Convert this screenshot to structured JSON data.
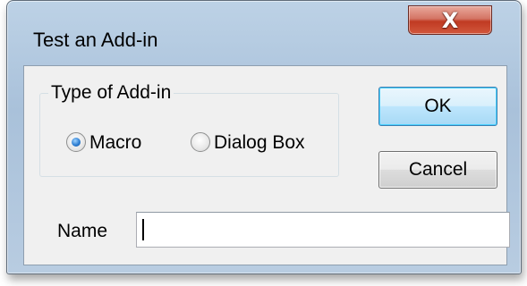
{
  "window": {
    "title": "Test an Add-in",
    "close_glyph": "X"
  },
  "group": {
    "label": "Type of Add-in",
    "options": [
      {
        "label": "Macro",
        "selected": true
      },
      {
        "label": "Dialog Box",
        "selected": false
      }
    ]
  },
  "buttons": {
    "ok": "OK",
    "cancel": "Cancel"
  },
  "name_field": {
    "label": "Name",
    "value": ""
  },
  "colors": {
    "title_bar": "#a9c1da",
    "close_button": "#c03a22",
    "client_bg": "#f0f0f0",
    "ok_border": "#3c7fb1"
  }
}
